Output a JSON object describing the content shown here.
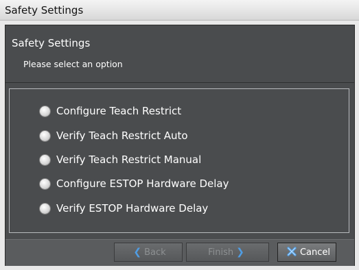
{
  "window": {
    "title": "Safety Settings"
  },
  "header": {
    "title": "Safety Settings",
    "subtitle": "Please select an option"
  },
  "options": [
    {
      "label": "Configure Teach Restrict",
      "selected": false
    },
    {
      "label": "Verify Teach Restrict Auto",
      "selected": false
    },
    {
      "label": "Verify Teach Restrict Manual",
      "selected": false
    },
    {
      "label": "Configure ESTOP Hardware Delay",
      "selected": false
    },
    {
      "label": "Verify ESTOP Hardware Delay",
      "selected": false
    }
  ],
  "buttons": {
    "back": {
      "label": "Back",
      "enabled": false,
      "icon": "chevron-left-icon"
    },
    "finish": {
      "label": "Finish",
      "enabled": false,
      "icon": "chevron-right-icon"
    },
    "cancel": {
      "label": "Cancel",
      "enabled": true,
      "icon": "cancel-x-icon"
    }
  },
  "colors": {
    "panel": "#4a4c4e",
    "footer": "#5a5c5e",
    "accent": "#4f9de4"
  }
}
